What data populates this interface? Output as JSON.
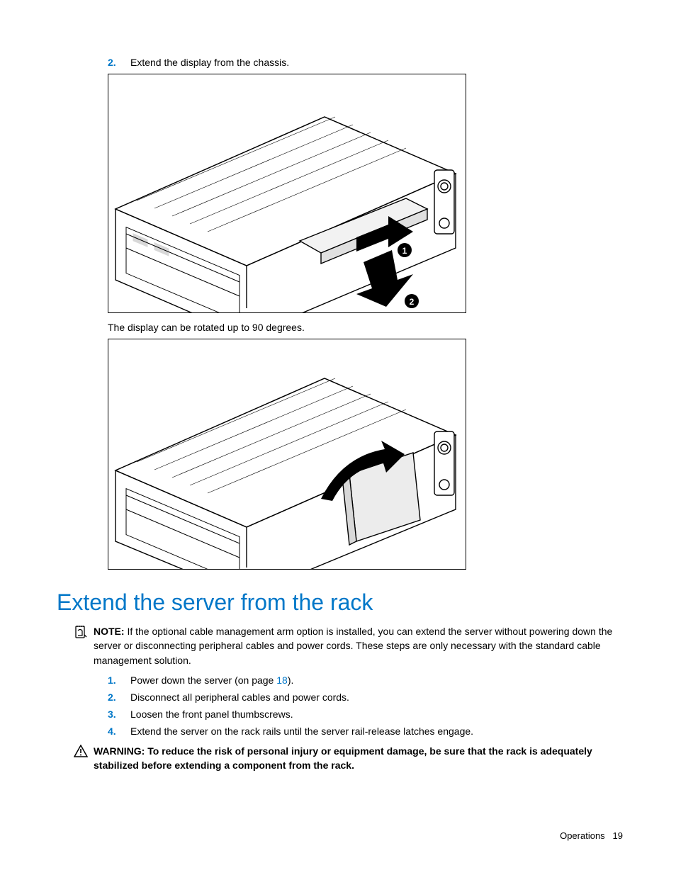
{
  "steps_top": {
    "num": "2.",
    "text": "Extend the display from the chassis."
  },
  "caption_mid": "The display can be rotated up to 90 degrees.",
  "heading": "Extend the server from the rack",
  "note": {
    "label": "NOTE:",
    "text": "  If the optional cable management arm option is installed, you can extend the server without powering down the server or disconnecting peripheral cables and power cords. These steps are only necessary with the standard cable management solution."
  },
  "steps_list": [
    {
      "num": "1.",
      "text_pre": "Power down the server (on page ",
      "page_ref": "18",
      "text_post": ")."
    },
    {
      "num": "2.",
      "text_pre": "Disconnect all peripheral cables and power cords.",
      "page_ref": "",
      "text_post": ""
    },
    {
      "num": "3.",
      "text_pre": "Loosen the front panel thumbscrews.",
      "page_ref": "",
      "text_post": ""
    },
    {
      "num": "4.",
      "text_pre": "Extend the server on the rack rails until the server rail-release latches engage.",
      "page_ref": "",
      "text_post": ""
    }
  ],
  "warning": {
    "label": "WARNING:",
    "text": "  To reduce the risk of personal injury or equipment damage, be sure that the rack is adequately stabilized before extending a component from the rack."
  },
  "footer": {
    "section": "Operations",
    "page": "19"
  },
  "callouts": {
    "c1": "1",
    "c2": "2"
  }
}
